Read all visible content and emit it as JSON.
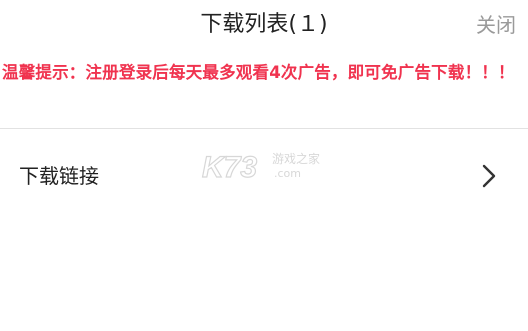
{
  "header": {
    "title": "下载列表(１)",
    "close_label": "关闭"
  },
  "notice": {
    "text": "温馨提示：注册登录后每天最多观看4次广告，即可免广告下载！！！",
    "color": "#f0334f"
  },
  "list": {
    "items": [
      {
        "label": "下载链接",
        "icon": "chevron-right-icon"
      }
    ]
  },
  "watermark": {
    "logo_text": "K73",
    "site_name": "游戏之家",
    "domain": ".com"
  }
}
